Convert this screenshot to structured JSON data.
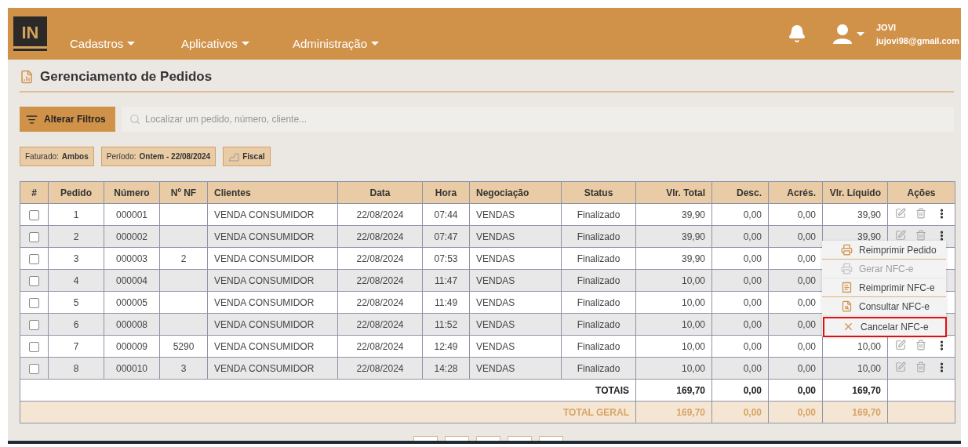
{
  "header": {
    "logo_text": "IN",
    "nav": [
      {
        "label": "Cadastros"
      },
      {
        "label": "Aplicativos"
      },
      {
        "label": "Administração"
      }
    ],
    "user": {
      "name": "JOVI",
      "email": "jujovi98@gmail.com"
    }
  },
  "page": {
    "title": "Gerenciamento de Pedidos"
  },
  "toolbar": {
    "filter_button": "Alterar Filtros",
    "search_placeholder": "Localizar um pedido, número, cliente..."
  },
  "chips": [
    {
      "kind": "pair",
      "label": "Faturado:",
      "value": "Ambos"
    },
    {
      "kind": "pair",
      "label": "Período:",
      "value": "Ontem - 22/08/2024"
    },
    {
      "kind": "icon",
      "value": "Fiscal"
    }
  ],
  "table": {
    "columns": [
      {
        "label": "#"
      },
      {
        "label": "Pedido"
      },
      {
        "label": "Número"
      },
      {
        "label": "Nº NF"
      },
      {
        "label": "Clientes"
      },
      {
        "label": "Data"
      },
      {
        "label": "Hora"
      },
      {
        "label": "Negociação"
      },
      {
        "label": "Status"
      },
      {
        "label": "Vlr. Total"
      },
      {
        "label": "Desc."
      },
      {
        "label": "Acrés."
      },
      {
        "label": "Vlr. Líquido"
      },
      {
        "label": "Ações"
      }
    ],
    "rows": [
      {
        "checked": false,
        "pedido": "1",
        "numero": "000001",
        "cliente": "VENDA CONSUMIDOR",
        "data": "22/08/2024",
        "hora": "07:44",
        "negociacao": "VENDAS",
        "status": "Finalizado",
        "total": "39,90",
        "desc": "0,00",
        "acres": "0,00",
        "liquido": "39,90"
      },
      {
        "checked": false,
        "pedido": "2",
        "numero": "000002",
        "cliente": "VENDA CONSUMIDOR",
        "data": "22/08/2024",
        "hora": "07:47",
        "negociacao": "VENDAS",
        "status": "Finalizado",
        "total": "39,90",
        "desc": "0,00",
        "acres": "0,00",
        "liquido": "39,90"
      },
      {
        "checked": false,
        "pedido": "3",
        "numero": "000003",
        "nf": "2",
        "cliente": "VENDA CONSUMIDOR",
        "data": "22/08/2024",
        "hora": "07:53",
        "negociacao": "VENDAS",
        "status": "Finalizado",
        "total": "39,90",
        "desc": "0,00",
        "acres": "0,00"
      },
      {
        "checked": false,
        "pedido": "4",
        "numero": "000004",
        "cliente": "VENDA CONSUMIDOR",
        "data": "22/08/2024",
        "hora": "11:47",
        "negociacao": "VENDAS",
        "status": "Finalizado",
        "total": "10,00",
        "desc": "0,00",
        "acres": "0,00"
      },
      {
        "checked": false,
        "pedido": "5",
        "numero": "000005",
        "cliente": "VENDA CONSUMIDOR",
        "data": "22/08/2024",
        "hora": "11:49",
        "negociacao": "VENDAS",
        "status": "Finalizado",
        "total": "10,00",
        "desc": "0,00",
        "acres": "0,00"
      },
      {
        "checked": false,
        "pedido": "6",
        "numero": "000008",
        "cliente": "VENDA CONSUMIDOR",
        "data": "22/08/2024",
        "hora": "11:52",
        "negociacao": "VENDAS",
        "status": "Finalizado",
        "total": "10,00",
        "desc": "0,00",
        "acres": "0,00"
      },
      {
        "checked": false,
        "pedido": "7",
        "numero": "000009",
        "nf": "5290",
        "cliente": "VENDA CONSUMIDOR",
        "data": "22/08/2024",
        "hora": "12:49",
        "negociacao": "VENDAS",
        "status": "Finalizado",
        "total": "10,00",
        "desc": "0,00",
        "acres": "0,00",
        "liquido": "10,00"
      },
      {
        "checked": false,
        "pedido": "8",
        "numero": "000010",
        "nf": "3",
        "cliente": "VENDA CONSUMIDOR",
        "data": "22/08/2024",
        "hora": "14:28",
        "negociacao": "VENDAS",
        "status": "Finalizado",
        "total": "10,00",
        "desc": "0,00",
        "acres": "0,00",
        "liquido": "10,00"
      }
    ],
    "totals": {
      "label": "TOTAIS",
      "total": "169,70",
      "desc": "0,00",
      "acres": "0,00",
      "liquido": "169,70"
    },
    "grand_total": {
      "label": "TOTAL GERAL",
      "total": "169,70",
      "desc": "0,00",
      "acres": "0,00",
      "liquido": "169,70"
    }
  },
  "menu": {
    "items": [
      {
        "label": "Reimprimir Pedido",
        "kind": "print",
        "disabled": false,
        "highlighted": false
      },
      {
        "label": "Gerar NFC-e",
        "kind": "print",
        "disabled": true,
        "highlighted": false
      },
      {
        "label": "Reimprimir NFC-e",
        "kind": "receipt",
        "disabled": false,
        "highlighted": false
      },
      {
        "label": "Consultar NFC-e",
        "kind": "lookup",
        "disabled": false,
        "highlighted": false
      },
      {
        "label": "Cancelar NFC-e",
        "kind": "cancel",
        "disabled": false,
        "highlighted": true
      }
    ]
  },
  "pagination": [
    {
      "selected": false
    },
    {
      "selected": false
    },
    {
      "selected": false
    },
    {
      "selected": false
    },
    {
      "selected": false
    }
  ]
}
